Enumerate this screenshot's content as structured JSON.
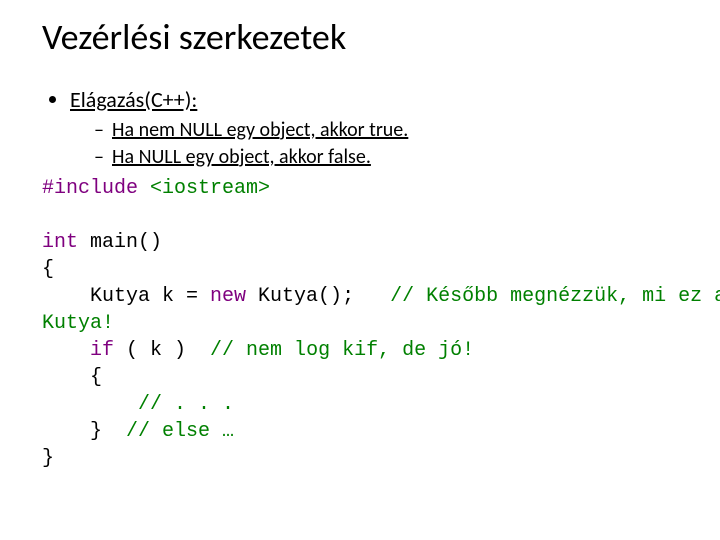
{
  "title": "Vezérlési szerkezetek",
  "bullet1": "Elágazás(C++):",
  "sub1": "Ha nem NULL egy object, akkor true.",
  "sub2": "Ha NULL egy object, akkor false.",
  "code": {
    "l1a": "#include ",
    "l1b": "<iostream>",
    "blank1": "",
    "l2a": "int",
    "l2b": " main()",
    "l3": "{",
    "l4a": "    Kutya k = ",
    "l4b": "new",
    "l4c": " Kutya();   ",
    "l4d": "// Később megnézzük, mi ez a",
    "l5": "Kutya!",
    "l6a": "    ",
    "l6b": "if",
    "l6c": " ( k )  ",
    "l6d": "// nem log kif, de jó!",
    "l7": "    {",
    "l8a": "        ",
    "l8b": "// . . .",
    "l9a": "    }  ",
    "l9b": "// else …",
    "l10": "}"
  }
}
